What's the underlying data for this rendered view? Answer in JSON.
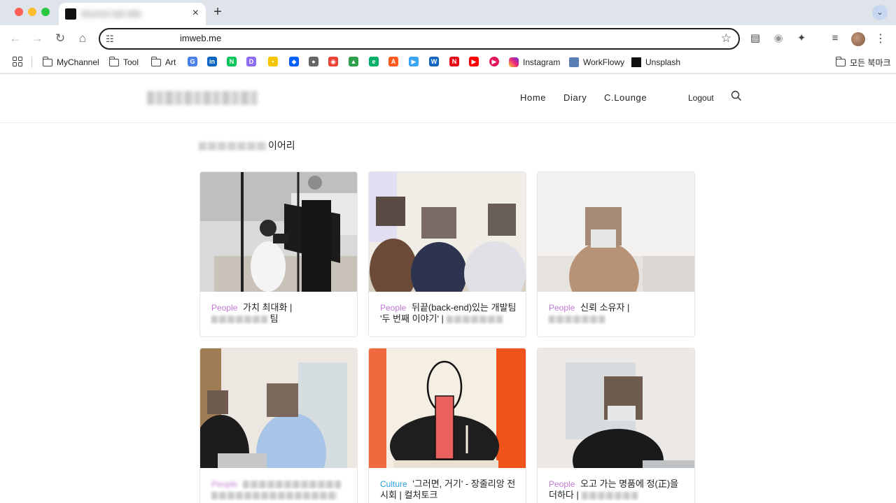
{
  "browser": {
    "tab_title": "blurred tab title",
    "new_tab": "+",
    "close_tab": "×",
    "url": "imweb.me",
    "bookmarks": [
      {
        "label": "MyChannel"
      },
      {
        "label": "Tool"
      },
      {
        "label": "Art"
      },
      {
        "label": "Instagram"
      },
      {
        "label": "WorkFlowy"
      },
      {
        "label": "Unsplash"
      }
    ],
    "all_bookmarks": "모든 북마크",
    "colors": {
      "chrome_bg": "#dfe3ea",
      "accent_people": "#c07ad0",
      "accent_culture": "#2a9fd6"
    }
  },
  "site": {
    "nav": {
      "home": "Home",
      "diary": "Diary",
      "lounge": "C.Lounge",
      "logout": "Logout"
    },
    "section_title_suffix": "이어리",
    "cards": [
      {
        "category": "People",
        "title": "가치 최대화 |",
        "title_tail": "팀"
      },
      {
        "category": "People",
        "title": "뒤끝(back-end)있는 개발팀 '두 번째 이야기' |",
        "title_tail": ""
      },
      {
        "category": "People",
        "title": "신뢰 소유자 |",
        "title_tail": ""
      },
      {
        "category": "People",
        "title": "",
        "title_tail": ""
      },
      {
        "category": "Culture",
        "title": "'그러면, 거기' - 장줄리앙 전시회 | 컬처토크",
        "title_tail": ""
      },
      {
        "category": "People",
        "title": "오고 가는 명품에 정(正)을 더하다 |",
        "title_tail": ""
      }
    ]
  }
}
